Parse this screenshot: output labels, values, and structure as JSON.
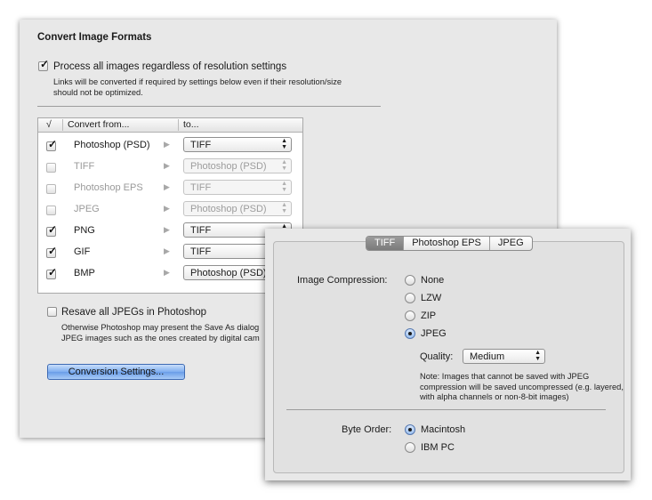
{
  "main": {
    "title": "Convert Image Formats",
    "process_label": "Process all images regardless of resolution settings",
    "process_checked": true,
    "process_note": "Links will be converted if required by settings below even if their resolution/size should not be optimized.",
    "table": {
      "headers": [
        "√",
        "Convert from...",
        "to..."
      ],
      "rows": [
        {
          "checked": true,
          "enabled": true,
          "from": "Photoshop (PSD)",
          "to": "TIFF"
        },
        {
          "checked": false,
          "enabled": false,
          "from": "TIFF",
          "to": "Photoshop (PSD)"
        },
        {
          "checked": false,
          "enabled": false,
          "from": "Photoshop EPS",
          "to": "TIFF"
        },
        {
          "checked": false,
          "enabled": false,
          "from": "JPEG",
          "to": "Photoshop (PSD)"
        },
        {
          "checked": true,
          "enabled": true,
          "from": "PNG",
          "to": "TIFF"
        },
        {
          "checked": true,
          "enabled": true,
          "from": "GIF",
          "to": "TIFF"
        },
        {
          "checked": true,
          "enabled": true,
          "from": "BMP",
          "to": "Photoshop (PSD)"
        }
      ]
    },
    "resave_label": "Resave all JPEGs in Photoshop",
    "resave_checked": false,
    "resave_note_line1": "Otherwise Photoshop may present the Save As dialog",
    "resave_note_line2": "JPEG images such as the ones created by digital cam",
    "conversion_button": "Conversion Settings..."
  },
  "settings": {
    "tabs": [
      {
        "label": "TIFF",
        "active": true
      },
      {
        "label": "Photoshop EPS",
        "active": false
      },
      {
        "label": "JPEG",
        "active": false
      }
    ],
    "compression_label": "Image Compression:",
    "compression_options": [
      "None",
      "LZW",
      "ZIP",
      "JPEG"
    ],
    "compression_selected": "JPEG",
    "quality_label": "Quality:",
    "quality_value": "Medium",
    "note": "Note: Images that cannot be saved with JPEG compression will be saved uncompressed (e.g. layered, with alpha channels or non-8-bit images)",
    "byte_order_label": "Byte Order:",
    "byte_order_options": [
      "Macintosh",
      "IBM PC"
    ],
    "byte_order_selected": "Macintosh"
  }
}
